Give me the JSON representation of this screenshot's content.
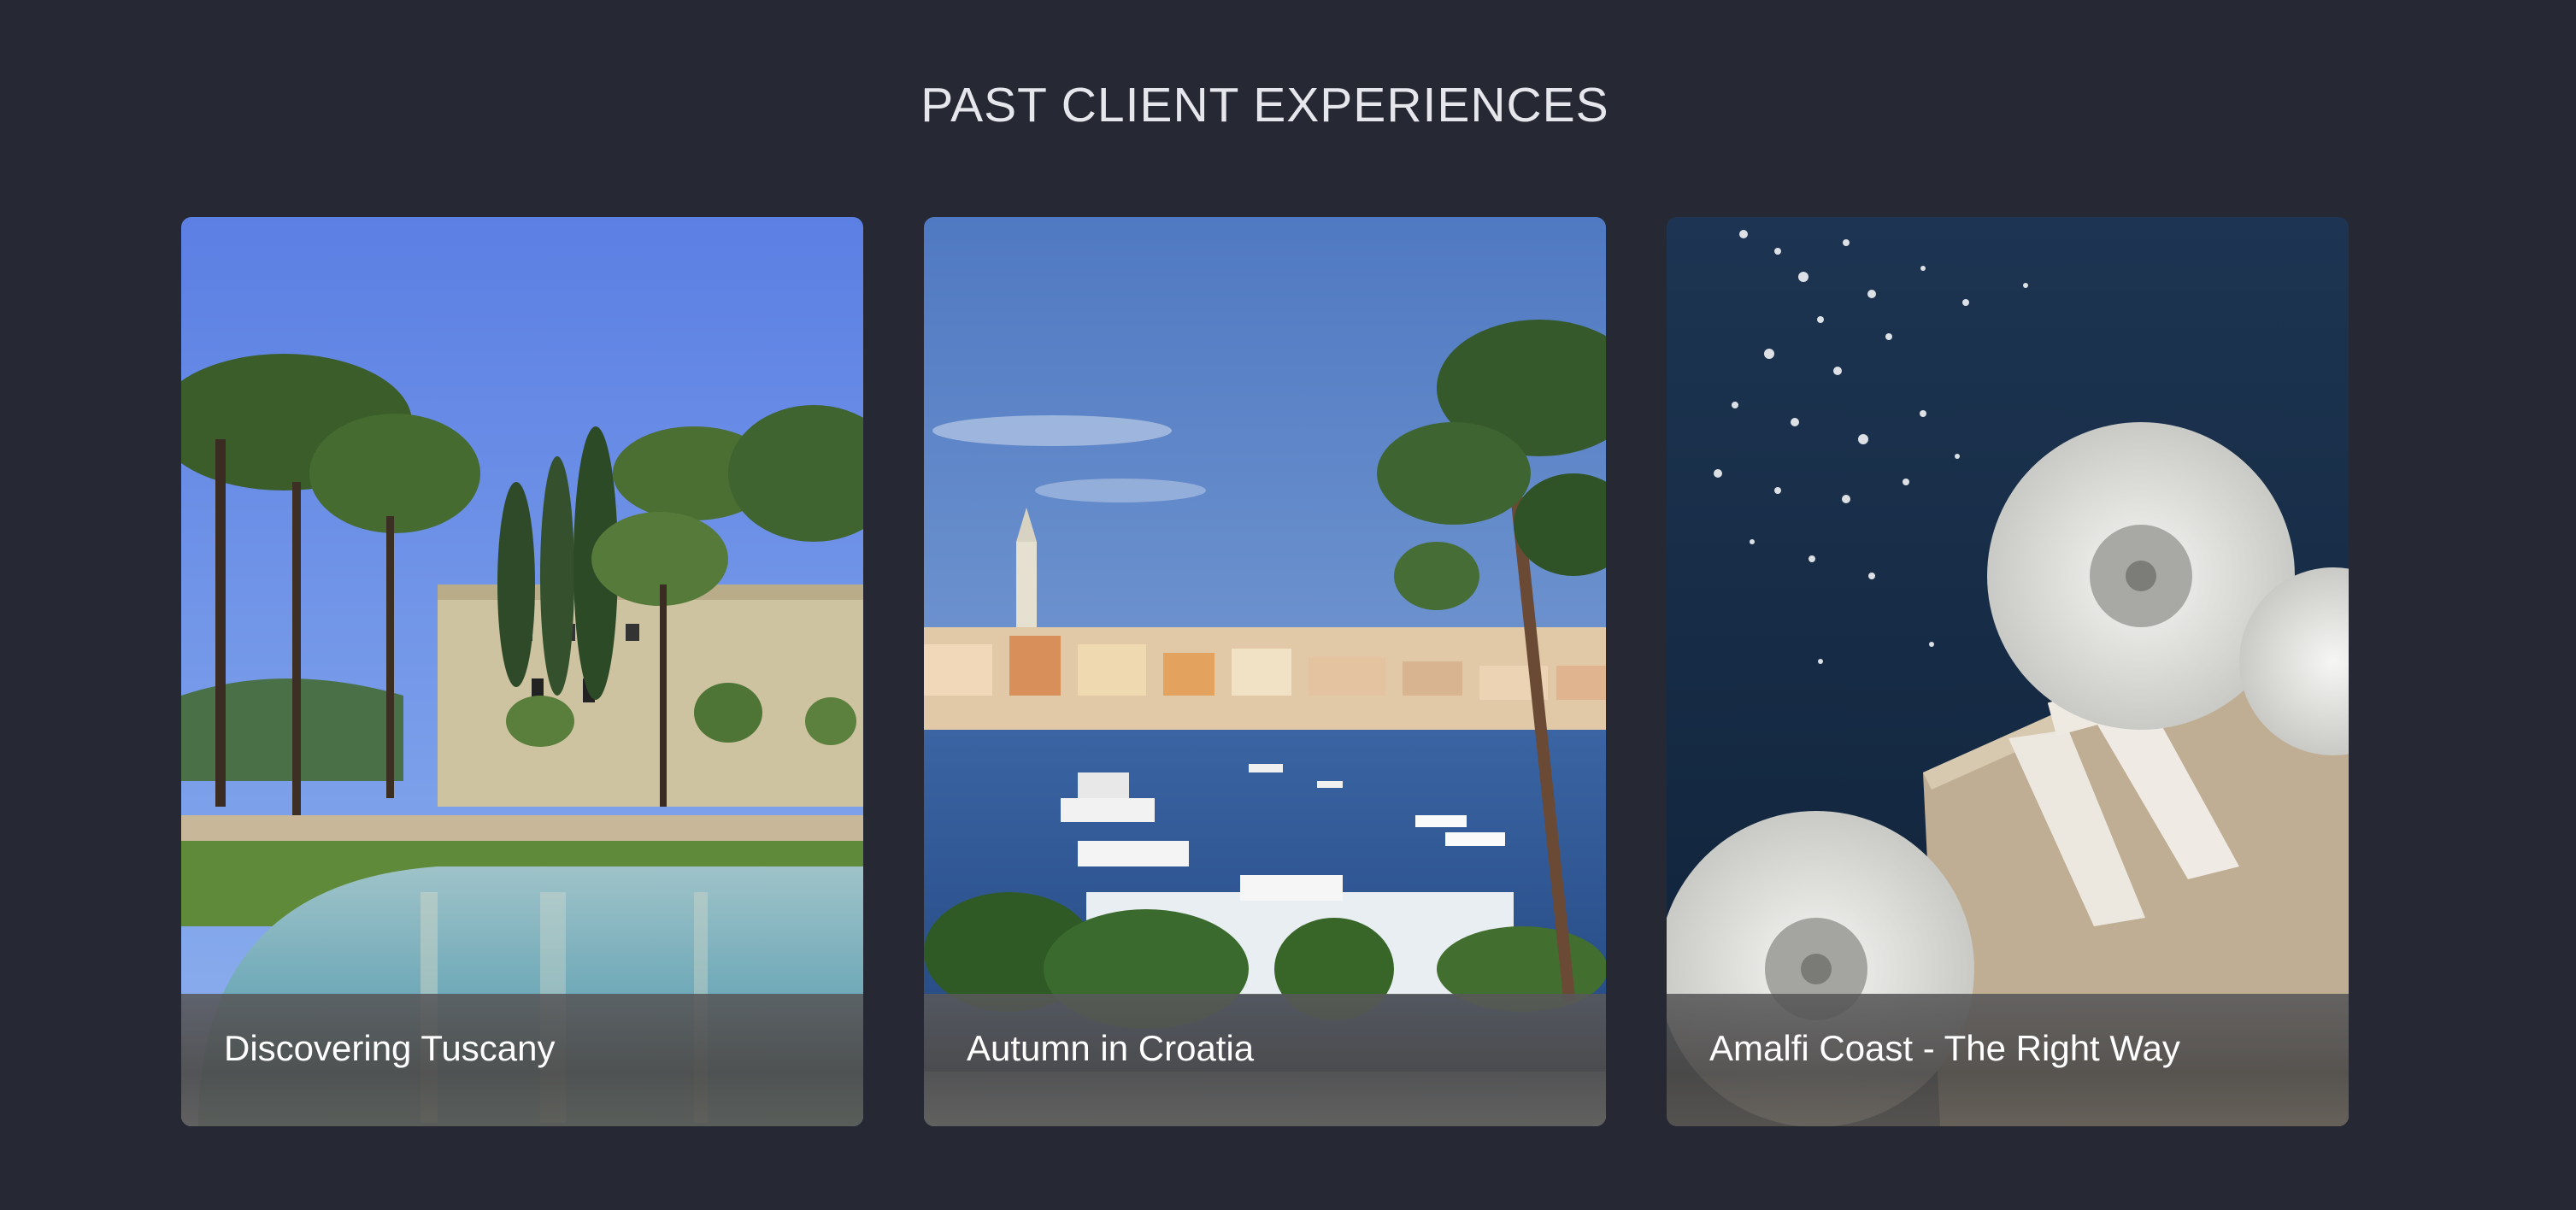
{
  "section": {
    "title": "PAST CLIENT EXPERIENCES"
  },
  "cards": [
    {
      "title": "Discovering Tuscany",
      "image": "tuscany-villa-pool-photo"
    },
    {
      "title": "Autumn in Croatia",
      "image": "croatia-harbor-town-photo"
    },
    {
      "title": "Amalfi Coast - The Right Way",
      "image": "amalfi-sea-umbrellas-photo"
    }
  ],
  "colors": {
    "background": "#262833",
    "title": "#e6e7ec",
    "caption_text": "#ffffff"
  }
}
